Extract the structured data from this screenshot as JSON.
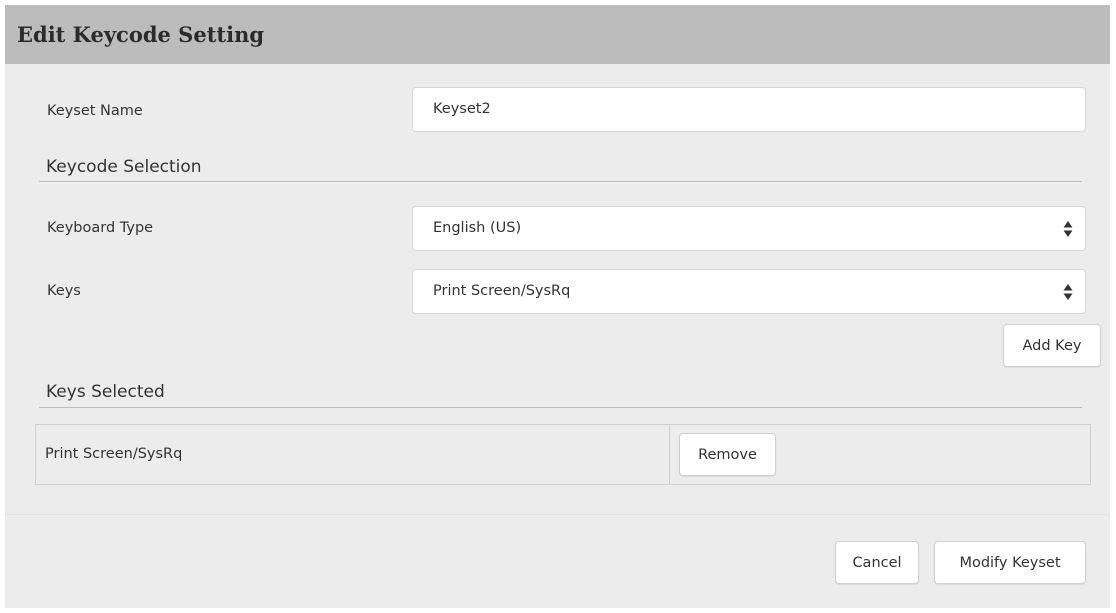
{
  "dialog": {
    "title": "Edit Keycode Setting"
  },
  "keyset_name": {
    "label": "Keyset Name",
    "value": "Keyset2"
  },
  "keycode_selection": {
    "heading": "Keycode Selection",
    "keyboard_type": {
      "label": "Keyboard Type",
      "selected": "English (US)"
    },
    "keys": {
      "label": "Keys",
      "selected": "Print Screen/SysRq"
    },
    "add_key_label": "Add Key"
  },
  "keys_selected": {
    "heading": "Keys Selected",
    "rows": [
      {
        "key": "Print Screen/SysRq",
        "remove_label": "Remove"
      }
    ]
  },
  "footer": {
    "cancel_label": "Cancel",
    "modify_label": "Modify Keyset"
  },
  "icons": {
    "select_arrows": "updown-icon"
  },
  "colors": {
    "title_bar": "#bcbcbc",
    "panel": "#ececec",
    "input_bg": "#ffffff"
  }
}
